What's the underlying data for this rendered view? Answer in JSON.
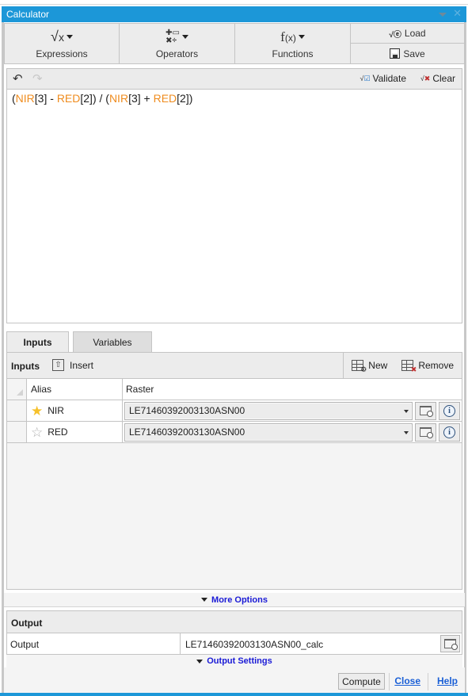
{
  "window": {
    "title": "Calculator",
    "controls": [
      "dropdown-icon",
      "close-icon"
    ]
  },
  "ribbon": {
    "expressions": {
      "label": "Expressions",
      "icon": "sqrt-x-icon",
      "glyph": "√x"
    },
    "operators": {
      "label": "Operators",
      "icon": "operators-icon",
      "glyph": "±÷"
    },
    "functions": {
      "label": "Functions",
      "icon": "function-icon",
      "glyph": "f(x)"
    },
    "load": {
      "label": "Load",
      "icon": "load-expression-icon"
    },
    "save": {
      "label": "Save",
      "icon": "save-icon"
    }
  },
  "editor_toolbar": {
    "undo_icon": "undo-icon",
    "redo_icon": "redo-icon",
    "validate_label": "Validate",
    "clear_label": "Clear"
  },
  "expression": {
    "tokens": [
      {
        "text": "(",
        "type": "op"
      },
      {
        "text": "NIR",
        "type": "var"
      },
      {
        "text": "[3] - ",
        "type": "op"
      },
      {
        "text": "RED",
        "type": "var"
      },
      {
        "text": "[2]) / (",
        "type": "op"
      },
      {
        "text": "NIR",
        "type": "var"
      },
      {
        "text": "[3] + ",
        "type": "op"
      },
      {
        "text": "RED",
        "type": "var"
      },
      {
        "text": "[2])",
        "type": "op"
      }
    ],
    "var_color": "#ef8c1f"
  },
  "tabs": [
    {
      "label": "Inputs",
      "active": true
    },
    {
      "label": "Variables",
      "active": false
    }
  ],
  "inputs": {
    "title": "Inputs",
    "insert_label": "Insert",
    "new_label": "New",
    "remove_label": "Remove",
    "columns": [
      "Alias",
      "Raster"
    ],
    "rows": [
      {
        "alias": "NIR",
        "starred": true,
        "raster": "LE71460392003130ASN00"
      },
      {
        "alias": "RED",
        "starred": false,
        "raster": "LE71460392003130ASN00"
      }
    ]
  },
  "more_options_label": "More Options",
  "output": {
    "section_title": "Output",
    "label": "Output",
    "value": "LE71460392003130ASN00_calc",
    "settings_label": "Output Settings"
  },
  "footer": {
    "compute_label": "Compute",
    "close_label": "Close",
    "help_label": "Help"
  },
  "colors": {
    "titlebar": "#1c97d8",
    "link": "#1a5fd6",
    "variable": "#ef8c1f"
  }
}
